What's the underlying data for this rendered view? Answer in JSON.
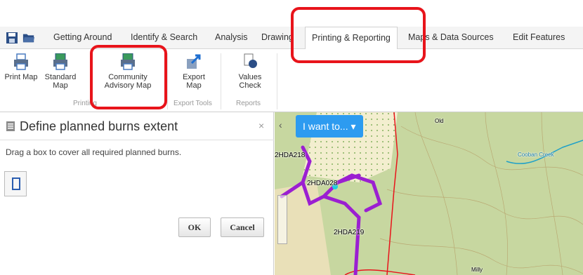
{
  "tabs": [
    "Getting Around",
    "Identify & Search",
    "Analysis",
    "Drawing",
    "Printing & Reporting",
    "Maps & Data Sources",
    "Edit Features"
  ],
  "ribbon": {
    "buttons": [
      {
        "line1": "Print Map",
        "line2": ""
      },
      {
        "line1": "Standard",
        "line2": "Map"
      },
      {
        "line1": "Community",
        "line2": "Advisory Map"
      },
      {
        "line1": "Export",
        "line2": "Map"
      },
      {
        "line1": "Values",
        "line2": "Check"
      }
    ],
    "groups": [
      "Printing",
      "Export Tools",
      "Reports"
    ]
  },
  "panel": {
    "title": "Define planned burns extent",
    "close": "×",
    "instruction": "Drag a box to cover all required planned burns.",
    "ok_label": "OK",
    "cancel_label": "Cancel"
  },
  "map": {
    "i_want_to": "I want to... ▾",
    "collapse": "‹",
    "labels": [
      "2HDA218",
      "2HDA028",
      "2HDA219",
      "Old",
      "Cooban Creek",
      "Milly"
    ]
  },
  "colors": {
    "accent": "#2d9bf0",
    "highlight": "#e8141b",
    "route": "#9b1fd1"
  }
}
